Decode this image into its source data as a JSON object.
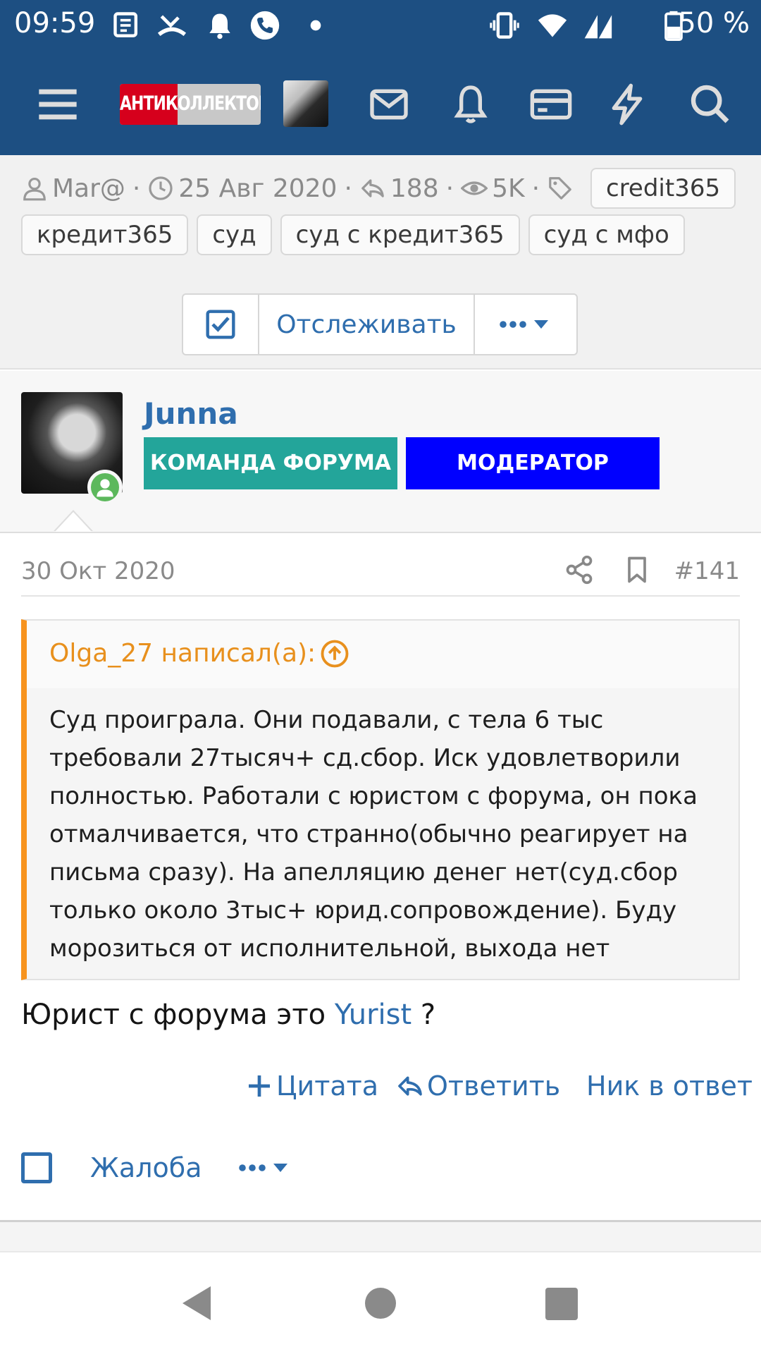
{
  "status_bar": {
    "time": "09:59",
    "battery": "50 %",
    "icons": [
      "news-icon",
      "missed-call-icon",
      "bell-icon",
      "phone-icon",
      "dot-icon",
      "vibrate-icon",
      "wifi-icon",
      "signal-icon",
      "battery-icon"
    ]
  },
  "header": {
    "logo_text": "АНТИКОЛЛЕКТОР",
    "icons": [
      "menu-icon",
      "mail-icon",
      "bell-icon",
      "card-icon",
      "lightning-icon",
      "search-icon"
    ]
  },
  "thread_meta": {
    "author": "Mar@",
    "date": "25 Авг 2020",
    "replies": "188",
    "views": "5K",
    "tags": [
      "credit365",
      "кредит365",
      "суд",
      "суд с кредит365",
      "суд с мфо"
    ],
    "watch_label": "Отслеживать",
    "more_label": "•••"
  },
  "post": {
    "username": "Junna",
    "badges": [
      "КОМАНДА ФОРУМА",
      "МОДЕРАТОР"
    ],
    "date": "30 Окт 2020",
    "number": "#141",
    "quote": {
      "author": "Olga_27 написал(а):",
      "text": "Суд проиграла. Они подавали, с тела 6 тыс требовали 27тысяч+ сд.сбор. Иск удовлетворили полностью. Работали с юристом с форума, он пока отмалчивается, что странно(обычно реагирует на письма сразу). На апелляцию денег нет(суд.сбор только около 3тыс+ юрид.сопровождение). Буду морозиться от исполнительной, выхода нет"
    },
    "reply_prefix": "Юрист с форума это ",
    "reply_link": "Yurist",
    "reply_suffix": " ?",
    "actions": {
      "quote": "Цитата",
      "reply": "Ответить",
      "nick": "Ник в ответ"
    },
    "report": "Жалоба"
  },
  "colors": {
    "header_bg": "#1d4f82",
    "link": "#2f6eae",
    "team_badge": "#23a59a",
    "mod_badge": "#0000ff",
    "quote_accent": "#f7931e"
  }
}
